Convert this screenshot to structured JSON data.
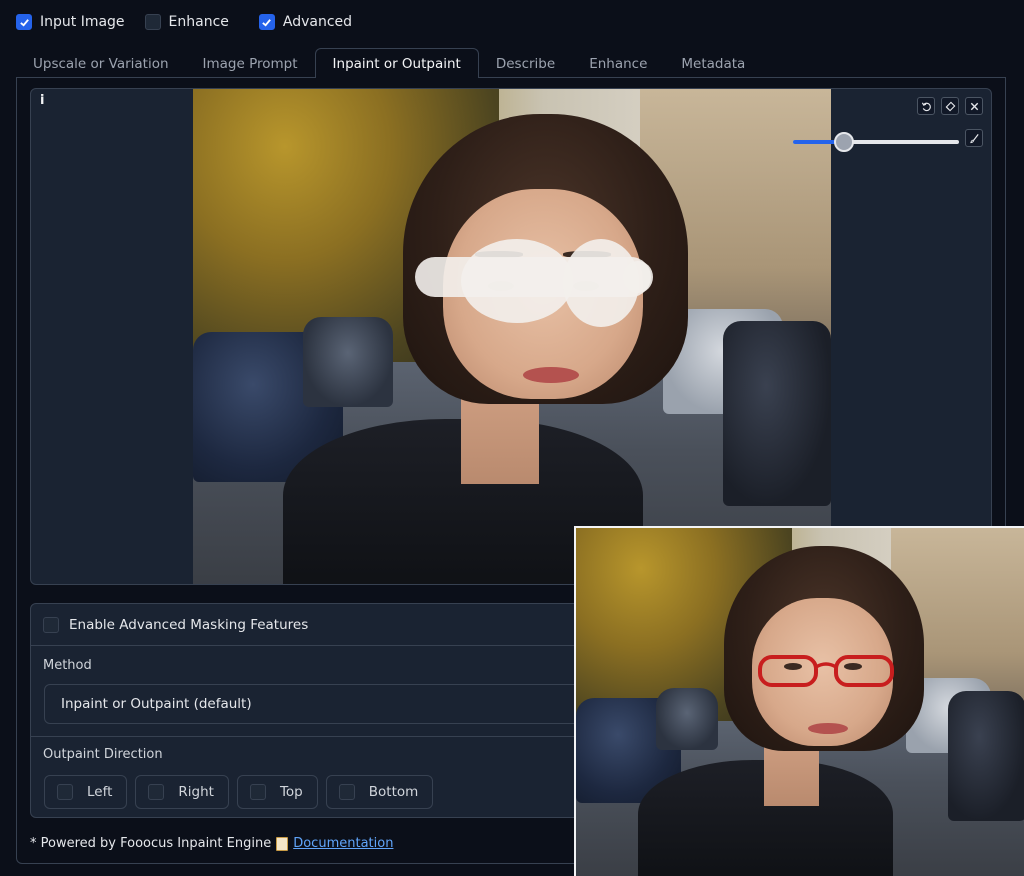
{
  "topbar": {
    "input_image": {
      "label": "Input Image",
      "checked": true
    },
    "enhance": {
      "label": "Enhance",
      "checked": false
    },
    "advanced": {
      "label": "Advanced",
      "checked": true
    }
  },
  "tabs": [
    {
      "label": "Upscale or Variation",
      "active": false
    },
    {
      "label": "Image Prompt",
      "active": false
    },
    {
      "label": "Inpaint or Outpaint",
      "active": true
    },
    {
      "label": "Describe",
      "active": false
    },
    {
      "label": "Enhance",
      "active": false
    },
    {
      "label": "Metadata",
      "active": false
    }
  ],
  "editor": {
    "label": "i",
    "tools": [
      "undo-icon",
      "eraser-icon",
      "close-icon",
      "brush-icon"
    ],
    "brush_size_fraction": 0.31
  },
  "options": {
    "advanced_masking": {
      "label": "Enable Advanced Masking Features",
      "checked": false
    },
    "method": {
      "label": "Method",
      "value": "Inpaint or Outpaint (default)"
    },
    "outpaint": {
      "label": "Outpaint Direction",
      "directions": [
        {
          "label": "Left",
          "checked": false
        },
        {
          "label": "Right",
          "checked": false
        },
        {
          "label": "Top",
          "checked": false
        },
        {
          "label": "Bottom",
          "checked": false
        }
      ]
    }
  },
  "footer": {
    "text": "* Powered by Fooocus Inpaint Engine",
    "icon": "document-icon",
    "link": "Documentation"
  },
  "colors": {
    "accent": "#2563eb",
    "background": "#0b0f19",
    "panel": "#1a2332",
    "link": "#60a5fa"
  }
}
